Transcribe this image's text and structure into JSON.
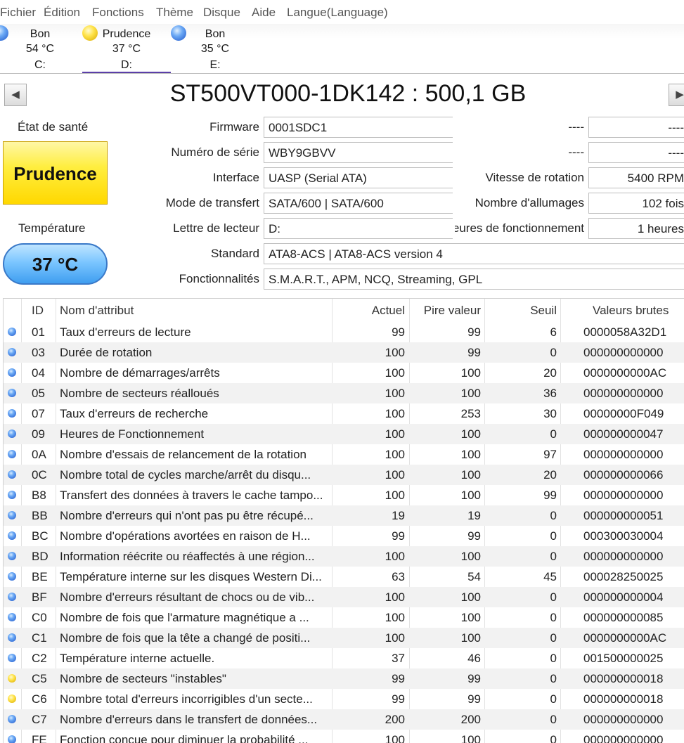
{
  "menu": [
    "Fichier",
    "Édition",
    "Fonctions",
    "Thème",
    "Disque",
    "Aide",
    "Langue(Language)"
  ],
  "disks": [
    {
      "status": "Bon",
      "temp": "54 °C",
      "letter": "C:",
      "color": "blue"
    },
    {
      "status": "Prudence",
      "temp": "37 °C",
      "letter": "D:",
      "color": "yellow"
    },
    {
      "status": "Bon",
      "temp": "35 °C",
      "letter": "E:",
      "color": "blue"
    }
  ],
  "nav": {
    "prev": "◀",
    "next": "▶"
  },
  "model_title": "ST500VT000-1DK142 : 500,1 GB",
  "health": {
    "label": "État de santé",
    "value": "Prudence"
  },
  "temperature": {
    "label": "Température",
    "value": "37 °C"
  },
  "info": {
    "firmware": {
      "label": "Firmware",
      "value": "0001SDC1"
    },
    "serial": {
      "label": "Numéro de série",
      "value": "WBY9GBVV"
    },
    "interface": {
      "label": "Interface",
      "value": "UASP (Serial ATA)"
    },
    "transfer": {
      "label": "Mode de transfert",
      "value": "SATA/600 | SATA/600"
    },
    "drive_letter": {
      "label": "Lettre de lecteur",
      "value": "D:"
    },
    "standard": {
      "label": "Standard",
      "value": "ATA8-ACS | ATA8-ACS version 4"
    },
    "features": {
      "label": "Fonctionnalités",
      "value": "S.M.A.R.T., APM, NCQ, Streaming, GPL"
    }
  },
  "right_info": {
    "r1": {
      "label": "----",
      "value": "----"
    },
    "r2": {
      "label": "----",
      "value": "----"
    },
    "rotation": {
      "label": "Vitesse de rotation",
      "value": "5400 RPM"
    },
    "power_on_count": {
      "label": "Nombre d'allumages",
      "value": "102 fois"
    },
    "power_on_hours": {
      "label": "Heures de fonctionnement",
      "value": "1 heures"
    }
  },
  "table": {
    "headers": {
      "id": "ID",
      "name": "Nom d'attribut",
      "current": "Actuel",
      "worst": "Pire valeur",
      "threshold": "Seuil",
      "raw": "Valeurs brutes"
    },
    "rows": [
      {
        "status": "blue",
        "id": "01",
        "name": "Taux d'erreurs de lecture",
        "current": "99",
        "worst": "99",
        "threshold": "6",
        "raw": "0000058A32D1"
      },
      {
        "status": "blue",
        "id": "03",
        "name": "Durée de rotation",
        "current": "100",
        "worst": "99",
        "threshold": "0",
        "raw": "000000000000"
      },
      {
        "status": "blue",
        "id": "04",
        "name": "Nombre de démarrages/arrêts",
        "current": "100",
        "worst": "100",
        "threshold": "20",
        "raw": "0000000000AC"
      },
      {
        "status": "blue",
        "id": "05",
        "name": "Nombre de secteurs réalloués",
        "current": "100",
        "worst": "100",
        "threshold": "36",
        "raw": "000000000000"
      },
      {
        "status": "blue",
        "id": "07",
        "name": "Taux d'erreurs de recherche",
        "current": "100",
        "worst": "253",
        "threshold": "30",
        "raw": "00000000F049"
      },
      {
        "status": "blue",
        "id": "09",
        "name": "Heures de Fonctionnement",
        "current": "100",
        "worst": "100",
        "threshold": "0",
        "raw": "000000000047"
      },
      {
        "status": "blue",
        "id": "0A",
        "name": "Nombre d'essais de relancement de la rotation",
        "current": "100",
        "worst": "100",
        "threshold": "97",
        "raw": "000000000000"
      },
      {
        "status": "blue",
        "id": "0C",
        "name": "Nombre total de cycles marche/arrêt du disqu...",
        "current": "100",
        "worst": "100",
        "threshold": "20",
        "raw": "000000000066"
      },
      {
        "status": "blue",
        "id": "B8",
        "name": "Transfert des données à travers le cache tampo...",
        "current": "100",
        "worst": "100",
        "threshold": "99",
        "raw": "000000000000"
      },
      {
        "status": "blue",
        "id": "BB",
        "name": "Nombre d'erreurs qui n'ont pas pu être récupé...",
        "current": "19",
        "worst": "19",
        "threshold": "0",
        "raw": "000000000051"
      },
      {
        "status": "blue",
        "id": "BC",
        "name": "Nombre d'opérations avortées en raison de H...",
        "current": "99",
        "worst": "99",
        "threshold": "0",
        "raw": "000300030004"
      },
      {
        "status": "blue",
        "id": "BD",
        "name": "Information réécrite ou réaffectés à une région...",
        "current": "100",
        "worst": "100",
        "threshold": "0",
        "raw": "000000000000"
      },
      {
        "status": "blue",
        "id": "BE",
        "name": "Température interne sur les disques Western Di...",
        "current": "63",
        "worst": "54",
        "threshold": "45",
        "raw": "000028250025"
      },
      {
        "status": "blue",
        "id": "BF",
        "name": "Nombre d'erreurs résultant de chocs ou de vib...",
        "current": "100",
        "worst": "100",
        "threshold": "0",
        "raw": "000000000004"
      },
      {
        "status": "blue",
        "id": "C0",
        "name": "Nombre de fois que l'armature magnétique a ...",
        "current": "100",
        "worst": "100",
        "threshold": "0",
        "raw": "000000000085"
      },
      {
        "status": "blue",
        "id": "C1",
        "name": "Nombre de fois que la tête a changé de positi...",
        "current": "100",
        "worst": "100",
        "threshold": "0",
        "raw": "0000000000AC"
      },
      {
        "status": "blue",
        "id": "C2",
        "name": "Température interne actuelle.",
        "current": "37",
        "worst": "46",
        "threshold": "0",
        "raw": "001500000025"
      },
      {
        "status": "yellow",
        "id": "C5",
        "name": "Nombre de secteurs \"instables\"",
        "current": "99",
        "worst": "99",
        "threshold": "0",
        "raw": "000000000018"
      },
      {
        "status": "yellow",
        "id": "C6",
        "name": "Nombre total d'erreurs incorrigibles d'un secte...",
        "current": "99",
        "worst": "99",
        "threshold": "0",
        "raw": "000000000018"
      },
      {
        "status": "blue",
        "id": "C7",
        "name": "Nombre d'erreurs dans le transfert de données...",
        "current": "200",
        "worst": "200",
        "threshold": "0",
        "raw": "000000000000"
      },
      {
        "status": "blue",
        "id": "FE",
        "name": "Fonction conçue pour diminuer la probabilité ...",
        "current": "100",
        "worst": "100",
        "threshold": "0",
        "raw": "000000000000"
      }
    ]
  }
}
